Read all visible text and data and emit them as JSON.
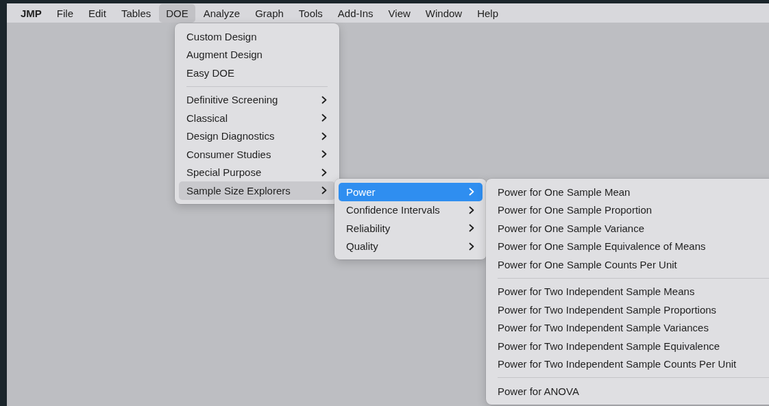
{
  "menubar": [
    {
      "label": "JMP",
      "kind": "app",
      "selected": false
    },
    {
      "label": "File",
      "kind": "menu",
      "selected": false
    },
    {
      "label": "Edit",
      "kind": "menu",
      "selected": false
    },
    {
      "label": "Tables",
      "kind": "menu",
      "selected": false
    },
    {
      "label": "DOE",
      "kind": "menu",
      "selected": true
    },
    {
      "label": "Analyze",
      "kind": "menu",
      "selected": false
    },
    {
      "label": "Graph",
      "kind": "menu",
      "selected": false
    },
    {
      "label": "Tools",
      "kind": "menu",
      "selected": false
    },
    {
      "label": "Add-Ins",
      "kind": "menu",
      "selected": false
    },
    {
      "label": "View",
      "kind": "menu",
      "selected": false
    },
    {
      "label": "Window",
      "kind": "menu",
      "selected": false
    },
    {
      "label": "Help",
      "kind": "menu",
      "selected": false
    }
  ],
  "menus": [
    {
      "items": [
        {
          "kind": "item",
          "label": "Custom Design",
          "selected": false
        },
        {
          "kind": "item",
          "label": "Augment Design",
          "selected": false
        },
        {
          "kind": "item",
          "label": "Easy DOE",
          "selected": false
        },
        {
          "kind": "separator"
        },
        {
          "kind": "item",
          "label": "Definitive Screening",
          "submenu": true,
          "selected": false
        },
        {
          "kind": "item",
          "label": "Classical",
          "submenu": true,
          "selected": false
        },
        {
          "kind": "item",
          "label": "Design Diagnostics",
          "submenu": true,
          "selected": false
        },
        {
          "kind": "item",
          "label": "Consumer Studies",
          "submenu": true,
          "selected": false
        },
        {
          "kind": "item",
          "label": "Special Purpose",
          "submenu": true,
          "selected": false
        },
        {
          "kind": "item",
          "label": "Sample Size Explorers",
          "submenu": true,
          "selected": true
        }
      ]
    },
    {
      "items": [
        {
          "kind": "item",
          "label": "Power",
          "submenu": true,
          "selected": true
        },
        {
          "kind": "item",
          "label": "Confidence Intervals",
          "submenu": true,
          "selected": false
        },
        {
          "kind": "item",
          "label": "Reliability",
          "submenu": true,
          "selected": false
        },
        {
          "kind": "item",
          "label": "Quality",
          "submenu": true,
          "selected": false
        }
      ]
    },
    {
      "items": [
        {
          "kind": "item",
          "label": "Power for One Sample Mean",
          "selected": false
        },
        {
          "kind": "item",
          "label": "Power for One Sample Proportion",
          "selected": false
        },
        {
          "kind": "item",
          "label": "Power for One Sample Variance",
          "selected": false
        },
        {
          "kind": "item",
          "label": "Power for One Sample Equivalence of Means",
          "selected": false
        },
        {
          "kind": "item",
          "label": "Power for One Sample Counts Per Unit",
          "selected": false
        },
        {
          "kind": "separator"
        },
        {
          "kind": "item",
          "label": "Power for Two Independent Sample Means",
          "selected": false
        },
        {
          "kind": "item",
          "label": "Power for Two Independent Sample Proportions",
          "selected": false
        },
        {
          "kind": "item",
          "label": "Power for Two Independent Sample Variances",
          "selected": false
        },
        {
          "kind": "item",
          "label": "Power for Two Independent Sample Equivalence",
          "selected": false
        },
        {
          "kind": "item",
          "label": "Power for Two Independent Sample Counts Per Unit",
          "selected": false
        },
        {
          "kind": "separator"
        },
        {
          "kind": "item",
          "label": "Power for ANOVA",
          "selected": false
        }
      ]
    }
  ]
}
